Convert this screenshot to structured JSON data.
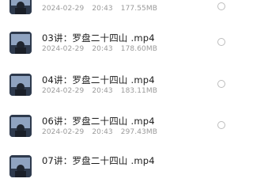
{
  "files": [
    {
      "name": "",
      "date": "2024-02-29",
      "time": "20:43",
      "size": "177.55MB"
    },
    {
      "name": "03讲：罗盘二十四山 .mp4",
      "date": "2024-02-29",
      "time": "20:43",
      "size": "178.60MB"
    },
    {
      "name": "04讲：罗盘二十四山 .mp4",
      "date": "2024-02-29",
      "time": "20:43",
      "size": "183.11MB"
    },
    {
      "name": "06讲：罗盘二十四山 .mp4",
      "date": "2024-02-29",
      "time": "20:43",
      "size": "297.43MB"
    },
    {
      "name": "07讲：罗盘二十四山 .mp4",
      "date": "",
      "time": "",
      "size": ""
    }
  ],
  "icons": {
    "thumbnail": "video-thumbnail-icon",
    "select": "radio-unchecked-icon"
  },
  "colors": {
    "title_text": "#1c1c1c",
    "meta_text": "#9a9a9a",
    "radio_border": "#bdbdbd"
  }
}
